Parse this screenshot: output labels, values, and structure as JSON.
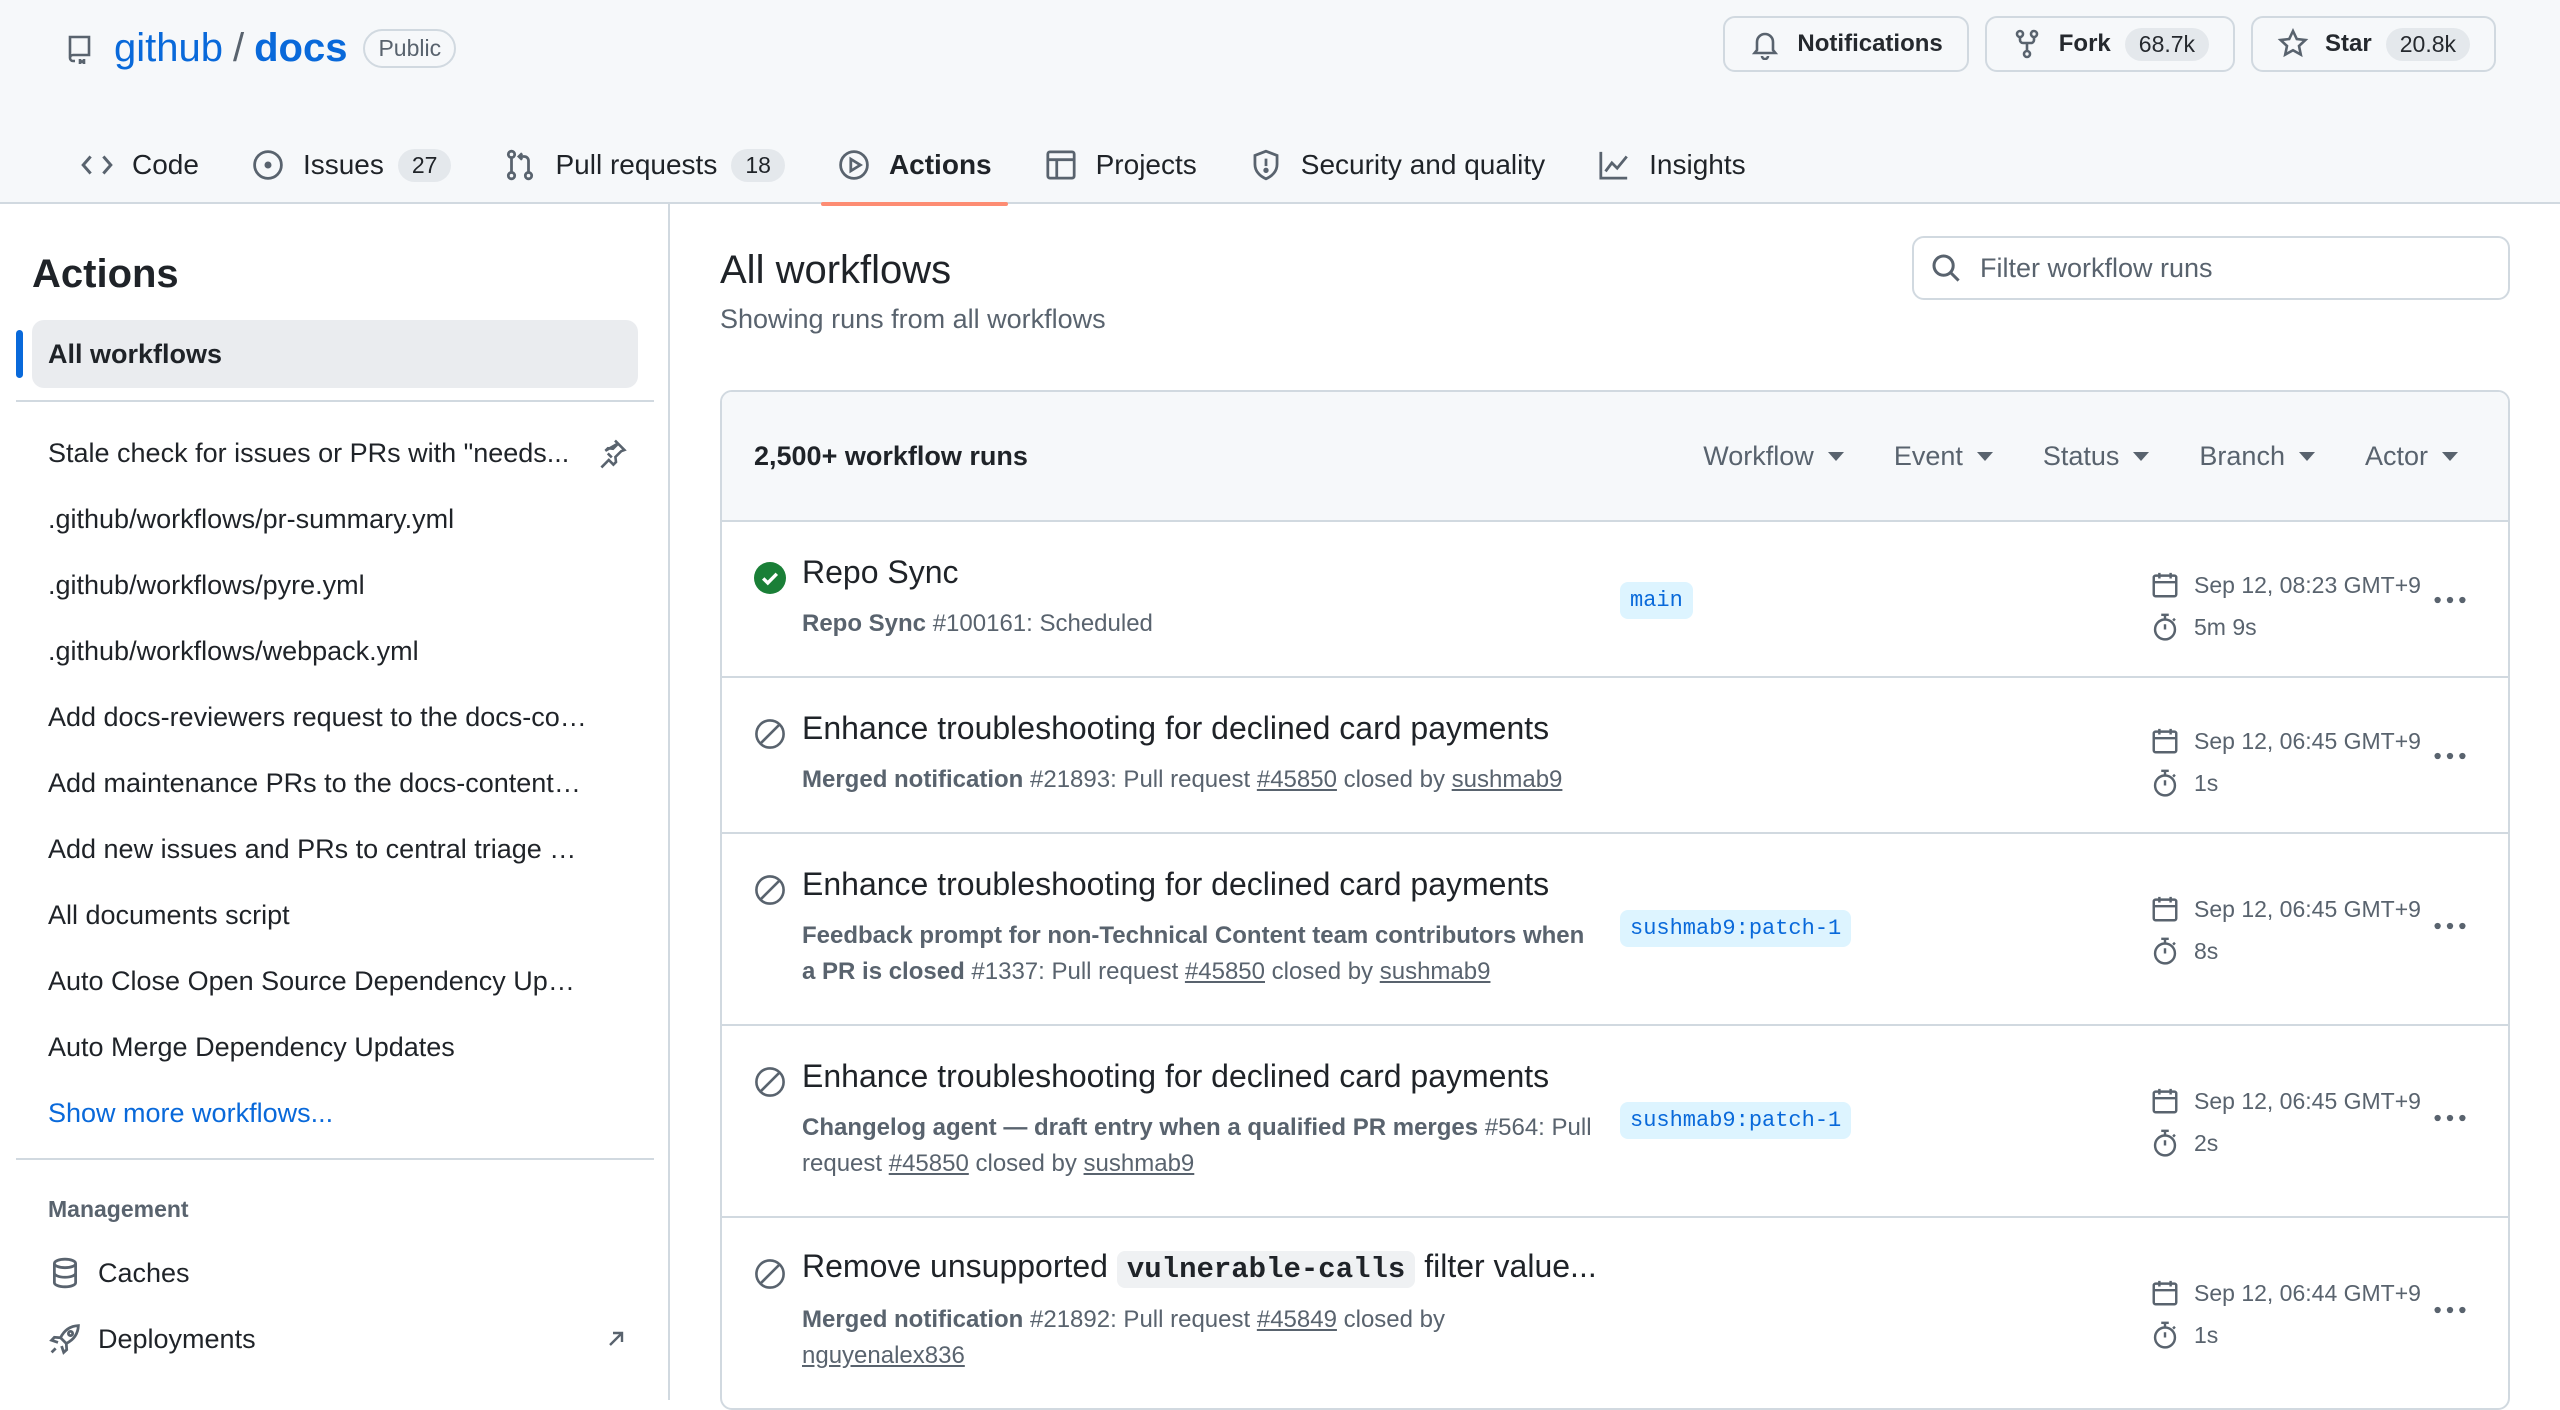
{
  "repo": {
    "owner": "github",
    "separator": "/",
    "name": "docs",
    "visibility": "Public"
  },
  "header_actions": {
    "notifications_label": "Notifications",
    "fork_label": "Fork",
    "fork_count": "68.7k",
    "star_label": "Star",
    "star_count": "20.8k"
  },
  "nav": {
    "code": "Code",
    "issues": "Issues",
    "issues_count": "27",
    "pull_requests": "Pull requests",
    "pull_requests_count": "18",
    "actions": "Actions",
    "projects": "Projects",
    "security": "Security and quality",
    "insights": "Insights",
    "active_tab": "actions"
  },
  "sidebar": {
    "title": "Actions",
    "selected": "All workflows",
    "workflows": [
      "Stale check for issues or PRs with \"needs...",
      ".github/workflows/pr-summary.yml",
      ".github/workflows/pyre.yml",
      ".github/workflows/webpack.yml",
      "Add docs-reviewers request to the docs-con...",
      "Add maintenance PRs to the docs-content F...",
      "Add new issues and PRs to central triage bo...",
      "All documents script",
      "Auto Close Open Source Dependency Updat...",
      "Auto Merge Dependency Updates"
    ],
    "show_more": "Show more workflows...",
    "management_label": "Management",
    "management": [
      "Caches",
      "Deployments"
    ]
  },
  "main": {
    "title": "All workflows",
    "subtitle": "Showing runs from all workflows",
    "filter_placeholder": "Filter workflow runs",
    "runs_count": "2,500+ workflow runs",
    "filters": [
      "Workflow",
      "Event",
      "Status",
      "Branch",
      "Actor"
    ]
  },
  "runs": [
    {
      "status": "success",
      "title": "Repo Sync",
      "workflow": "Repo Sync",
      "detail": " #100161: Scheduled",
      "branch": "main",
      "date": "Sep 12, 08:23 GMT+9",
      "duration": "5m 9s"
    },
    {
      "status": "skipped",
      "title": "Enhance troubleshooting for declined card payments",
      "workflow": "Merged notification",
      "detail": " #21893: Pull request ",
      "pr": "#45850",
      "closed_by": " closed by ",
      "actor": "sushmab9",
      "branch": "",
      "date": "Sep 12, 06:45 GMT+9",
      "duration": "1s"
    },
    {
      "status": "skipped",
      "title": "Enhance troubleshooting for declined card payments",
      "workflow": "Feedback prompt for non-Technical Content team contributors when a PR is closed",
      "detail": " #1337: Pull request ",
      "pr": "#45850",
      "closed_by": " closed by ",
      "actor": "sushmab9",
      "branch": "sushmab9:patch-1",
      "date": "Sep 12, 06:45 GMT+9",
      "duration": "8s"
    },
    {
      "status": "skipped",
      "title": "Enhance troubleshooting for declined card payments",
      "workflow": "Changelog agent — draft entry when a qualified PR merges",
      "detail": " #564: Pull request ",
      "pr": "#45850",
      "closed_by": " closed by ",
      "actor": "sushmab9",
      "branch": "sushmab9:patch-1",
      "date": "Sep 12, 06:45 GMT+9",
      "duration": "2s"
    },
    {
      "status": "skipped",
      "title_pre": "Remove unsupported ",
      "title_code": "vulnerable-calls",
      "title_post": " filter value...",
      "workflow": "Merged notification",
      "detail": " #21892: Pull request ",
      "pr": "#45849",
      "closed_by": " closed by ",
      "actor": "nguyenalex836",
      "branch": "",
      "date": "Sep 12, 06:44 GMT+9",
      "duration": "1s"
    }
  ],
  "colors": {
    "accent": "#0969da",
    "success": "#1a7f37",
    "active_tab_underline": "#fd8c73",
    "branch_bg": "#ddf4ff"
  }
}
